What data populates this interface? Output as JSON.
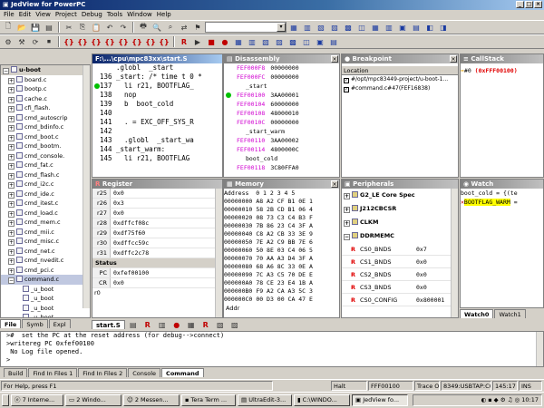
{
  "window": {
    "title": "JedView for PowerPC"
  },
  "menu": [
    "File",
    "Edit",
    "View",
    "Project",
    "Debug",
    "Tools",
    "Window",
    "Help"
  ],
  "project_tree": {
    "root": "u-boot",
    "items": [
      "board.c",
      "bootp.c",
      "cache.c",
      "cfi_flash.",
      "cmd_autoscrip",
      "cmd_bdinfo.c",
      "cmd_boot.c",
      "cmd_bootm.",
      "cmd_console.",
      "cmd_fat.c",
      "cmd_flash.c",
      "cmd_i2c.c",
      "cmd_ide.c",
      "cmd_itest.c",
      "cmd_load.c",
      "cmd_mem.c",
      "cmd_mii.c",
      "cmd_misc.c",
      "cmd_net.c",
      "cmd_nvedit.c",
      "cmd_pci.c",
      "command.c"
    ],
    "children": [
      "_u_boot",
      "_u_boot",
      "_u_boot",
      "_u_boot",
      "_u_boot",
      "_u_boot",
      "_u_boot"
    ],
    "tabs": [
      "File",
      "Symb",
      "Expl"
    ]
  },
  "editor": {
    "title": "F:\\...\\cpu\\mpc83xx\\start.S",
    "lines": [
      {
        "num": "",
        "code": ".globl  _start"
      },
      {
        "num": "136",
        "code": "_start: /* time t 0 *"
      },
      {
        "num": "137",
        "code": "  li r21, BOOTFLAG_"
      },
      {
        "num": "138",
        "code": "  nop"
      },
      {
        "num": "139",
        "code": "  b  boot_cold"
      },
      {
        "num": "140",
        "code": ""
      },
      {
        "num": "141",
        "code": "  . = EXC_OFF_SYS_R"
      },
      {
        "num": "142",
        "code": ""
      },
      {
        "num": "143",
        "code": "  .globl  _start_wa"
      },
      {
        "num": "144",
        "code": "_start_warm:"
      },
      {
        "num": "145",
        "code": "  li r21, BOOTFLAG"
      }
    ],
    "tab": "start.S"
  },
  "disassembly": {
    "title": "Disassembly",
    "lines": [
      {
        "addr": "FEF000F8",
        "val": "00000000",
        "t": "pink"
      },
      {
        "addr": "FEF000FC",
        "val": "00000000",
        "t": "pink"
      },
      {
        "addr": "",
        "val": "_start",
        "t": "label"
      },
      {
        "addr": "FEF00100",
        "val": "3AA00001",
        "t": "pink"
      },
      {
        "addr": "FEF00104",
        "val": "60000000",
        "t": "pink"
      },
      {
        "addr": "FEF00108",
        "val": "48000010",
        "t": "pink"
      },
      {
        "addr": "FEF0010C",
        "val": "00000000",
        "t": "pink"
      },
      {
        "addr": "",
        "val": "_start_warm",
        "t": "label"
      },
      {
        "addr": "FEF00110",
        "val": "3AA00002",
        "t": "pink"
      },
      {
        "addr": "FEF00114",
        "val": "4800000C",
        "t": "pink"
      },
      {
        "addr": "",
        "val": "boot_cold",
        "t": "label"
      },
      {
        "addr": "FEF00118",
        "val": "3C80FFA0",
        "t": "pink"
      }
    ]
  },
  "breakpoint": {
    "title": "Breakpoint",
    "column": "Location",
    "items": [
      "#/opt/mpc83449-project/u-boot-1...",
      "#command.c#47(FEF16838)"
    ]
  },
  "callstack": {
    "title": "CallStack",
    "entry_num": "#0",
    "entry_addr": "(0xFFF00100)"
  },
  "register": {
    "title": "Register",
    "rows": [
      {
        "n": "r25",
        "v": "0x0"
      },
      {
        "n": "r26",
        "v": "0x3"
      },
      {
        "n": "r27",
        "v": "0x0"
      },
      {
        "n": "r28",
        "v": "0xdffcf08c"
      },
      {
        "n": "r29",
        "v": "0xdf75f60"
      },
      {
        "n": "r30",
        "v": "0xdffcc59c"
      },
      {
        "n": "r31",
        "v": "0xdffc2c78"
      }
    ],
    "status_label": "Status",
    "status_rows": [
      {
        "n": "PC",
        "v": "0xfef00100"
      },
      {
        "n": "CR",
        "v": "0x0"
      }
    ],
    "footer": "r0"
  },
  "memory": {
    "title": "Memory",
    "header_addr": "Address",
    "header_val": "0 1 2 3 4 5",
    "rows": [
      {
        "a": "00000000",
        "b": "A8 A2 CF B1 0E 1"
      },
      {
        "a": "00000010",
        "b": "58 2B CD B1 06 4"
      },
      {
        "a": "00000020",
        "b": "08 73 C3 C4 B3 F"
      },
      {
        "a": "00000030",
        "b": "7B 86 23 C4 3F A"
      },
      {
        "a": "00000040",
        "b": "C8 A2 CB 33 3E 9"
      },
      {
        "a": "00000050",
        "b": "7E A2 C9 BB 7E 6"
      },
      {
        "a": "00000060",
        "b": "50 8E 03 C4 06 5"
      },
      {
        "a": "00000070",
        "b": "70 AA A3 D4 3F A"
      },
      {
        "a": "00000080",
        "b": "68 A6 8C 33 0E A"
      },
      {
        "a": "00000090",
        "b": "7C A3 C5 70 DE E"
      },
      {
        "a": "000000A0",
        "b": "78 CE 23 E4 1B A"
      },
      {
        "a": "000000B0",
        "b": "F9 A2 CA A3 5C 3"
      },
      {
        "a": "000000C0",
        "b": "00 D3 00 CA 47 E"
      }
    ],
    "footer": "Addr"
  },
  "peripherals": {
    "title": "Peripherals",
    "groups": [
      {
        "label": "G2_LE Core Spec",
        "kind": "group"
      },
      {
        "label": "J212CBCSR",
        "kind": "group"
      },
      {
        "label": "CLKM",
        "kind": "group"
      },
      {
        "label": "DDRMEMC",
        "kind": "group"
      }
    ],
    "regs": [
      {
        "n": "CS0_BNDS",
        "v": "0x7"
      },
      {
        "n": "CS1_BNDS",
        "v": "0x0"
      },
      {
        "n": "CS2_BNDS",
        "v": "0x0"
      },
      {
        "n": "CS3_BNDS",
        "v": "0x0"
      },
      {
        "n": "CS0_CONFIG",
        "v": "0x800001"
      }
    ]
  },
  "watch": {
    "title": "Watch",
    "rows": [
      {
        "k": "boot_cold",
        "v": "= {(te"
      },
      {
        "k": "BOOTFLAG_WARM",
        "v": "="
      }
    ],
    "tabs": [
      "Watch0",
      "Watch1"
    ]
  },
  "console": {
    "lines": [
      ">#  set the PC at the reset address (for debug-->connect)",
      ">writereg PC 0xfef00100",
      " No Log file opened.",
      ">"
    ],
    "tabs": [
      "Build",
      "Find In Files 1",
      "Find In Files 2",
      "Console",
      "Command"
    ]
  },
  "statusbar": {
    "help": "For Help, press F1",
    "state": "Halt",
    "pc": "FFF00100",
    "trace": "Trace Off",
    "conn": "8349:USBTAP:CCS",
    "time": "145:17",
    "mode": "INS"
  },
  "taskbar": {
    "items": [
      "7 Interne...",
      "2 Windo...",
      "2 Messen...",
      "Tera Term ...",
      "UltraEdit-3...",
      "C:\\WINDO...",
      "JedView fo..."
    ],
    "clock": "10:17"
  }
}
